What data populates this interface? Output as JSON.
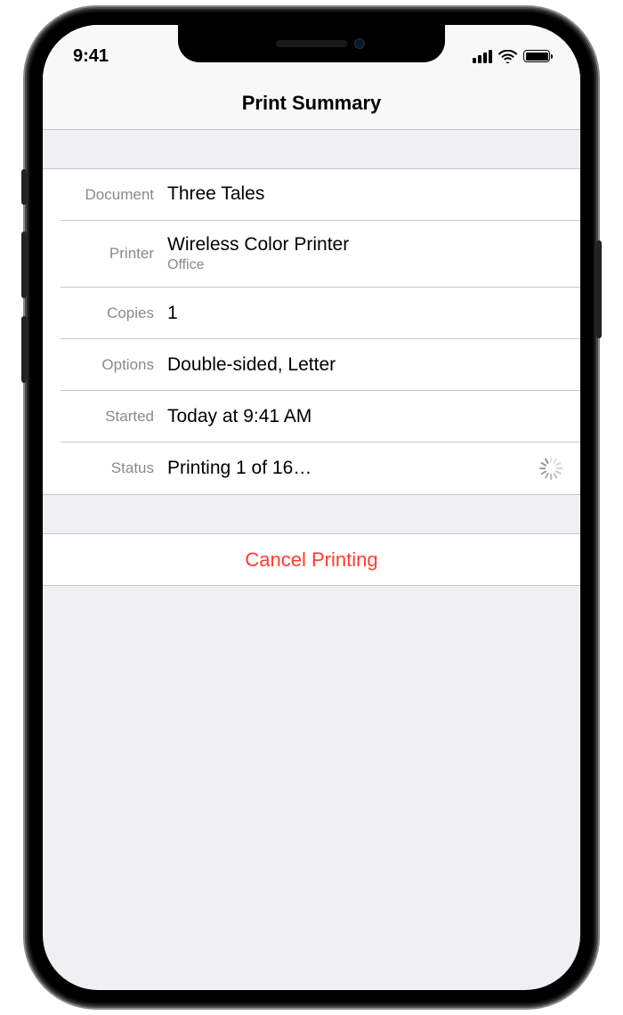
{
  "statusBar": {
    "time": "9:41"
  },
  "header": {
    "title": "Print Summary"
  },
  "rows": {
    "document": {
      "label": "Document",
      "value": "Three Tales"
    },
    "printer": {
      "label": "Printer",
      "value": "Wireless Color Printer",
      "sub": "Office"
    },
    "copies": {
      "label": "Copies",
      "value": "1"
    },
    "options": {
      "label": "Options",
      "value": "Double-sided, Letter"
    },
    "started": {
      "label": "Started",
      "value": "Today at 9:41 AM"
    },
    "status": {
      "label": "Status",
      "value": "Printing 1 of 16…"
    }
  },
  "actions": {
    "cancel": "Cancel Printing"
  },
  "colors": {
    "destructive": "#ff3b30",
    "secondaryText": "#8a8a8e",
    "groupedBg": "#efeff4"
  }
}
